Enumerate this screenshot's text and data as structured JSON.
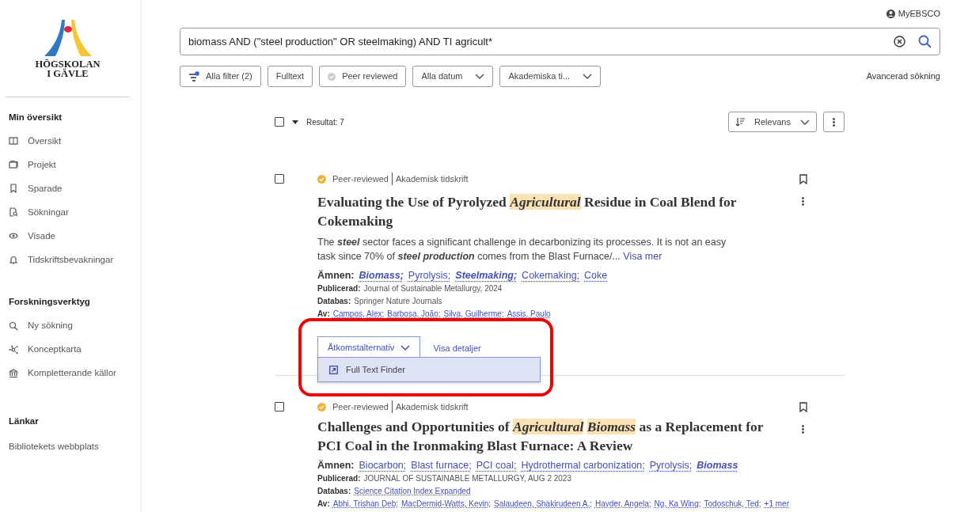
{
  "logo": {
    "lines": [
      "HÖGSKOLAN",
      "I GÄVLE"
    ]
  },
  "sidebar": {
    "sections": [
      {
        "title": "Min översikt",
        "items": [
          {
            "label": "Översikt"
          },
          {
            "label": "Projekt"
          },
          {
            "label": "Sparade"
          },
          {
            "label": "Sökningar"
          },
          {
            "label": "Visade"
          },
          {
            "label": "Tidskriftsbevakningar"
          }
        ]
      },
      {
        "title": "Forskningsverktyg",
        "items": [
          {
            "label": "Ny sökning"
          },
          {
            "label": "Konceptkarta"
          },
          {
            "label": "Kompletterande källor"
          }
        ]
      },
      {
        "title": "Länkar",
        "items": [
          {
            "label": "Bibliotekets webbplats"
          }
        ]
      }
    ]
  },
  "account": {
    "label": "MyEBSCO"
  },
  "search": {
    "value": "biomass AND (\"steel production\" OR steelmaking) AND TI agricult*"
  },
  "filters": [
    {
      "kind": "filter",
      "label": "Alla filter (2)",
      "active_dot": true
    },
    {
      "kind": "toggle",
      "label": "Fulltext"
    },
    {
      "kind": "check",
      "label": "Peer reviewed"
    },
    {
      "kind": "dropdown",
      "label": "Alla datum"
    },
    {
      "kind": "dropdown",
      "label": "Akademiska ti..."
    }
  ],
  "advanced_link": "Avancerad sökning",
  "results_bar": {
    "count": "Resultat: 7",
    "sort": "Relevans",
    "select_all": false
  },
  "results": [
    {
      "selected": false,
      "peer": "Peer-reviewed",
      "type": "Akademisk tidskrift",
      "title": "Evaluating the Use of Pyrolyzed *Agricultural* Residue in Coal Blend for Cokemaking",
      "abstract": "The **steel** sector faces a significant challenge in decarbonizing its processes. It is not an easy task since 70% of **steel production** comes from the Blast Furnace/...",
      "more": "Visa mer",
      "subjects_label": "Ämnen:",
      "subjects": [
        {
          "label": "Biomass;",
          "highlight": true
        },
        {
          "label": "Pyrolysis;",
          "highlight": false
        },
        {
          "label": "Steelmaking;",
          "highlight": true
        },
        {
          "label": "Cokemaking;",
          "highlight": false
        },
        {
          "label": "Coke",
          "highlight": false
        }
      ],
      "published_label": "Publicerad:",
      "published": "Journal of Sustainable Metallurgy, 2024",
      "published_link": false,
      "database_label": "Databas:",
      "database": "Springer Nature Journals",
      "database_link": false,
      "authors_label": "Av:",
      "authors": [
        "Campos, Alex;",
        "Barbosa, João;",
        "Silva, Guilherme;",
        "Assis, Paulo"
      ],
      "access": {
        "label": "Åtkomstalternativ",
        "expanded": true,
        "menu": [
          "Full Text Finder"
        ],
        "details": "Visa detaljer",
        "callout": true
      }
    },
    {
      "selected": false,
      "peer": "Peer-reviewed",
      "type": "Akademisk tidskrift",
      "title": "Challenges and Opportunities of *Agricultural* *Biomass* as a Replacement for PCI Coal in the Ironmaking Blast Furnace: A Review",
      "subjects_label": "Ämnen:",
      "subjects": [
        {
          "label": "Biocarbon;",
          "highlight": false
        },
        {
          "label": "Blast furnace;",
          "highlight": false
        },
        {
          "label": "PCI coal;",
          "highlight": false
        },
        {
          "label": "Hydrothermal carbonization;",
          "highlight": false
        },
        {
          "label": "Pyrolysis;",
          "highlight": false
        },
        {
          "label": "Biomass",
          "highlight": true
        }
      ],
      "published_label": "Publicerad:",
      "published": "JOURNAL OF SUSTAINABLE METALLURGY, AUG 2 2023",
      "published_link": false,
      "database_label": "Databas:",
      "database": "Science Citation Index Expanded",
      "database_link": true,
      "authors_label": "Av:",
      "authors": [
        "Abhi, Trishan Deb;",
        "MacDermid-Watts, Kevin;",
        "Salaudeen, Shakirudeen A.;",
        "Hayder, Angela;",
        "Ng, Ka Wing;",
        "Todoschuk, Ted;"
      ],
      "authors_more": "+1 mer"
    }
  ]
}
